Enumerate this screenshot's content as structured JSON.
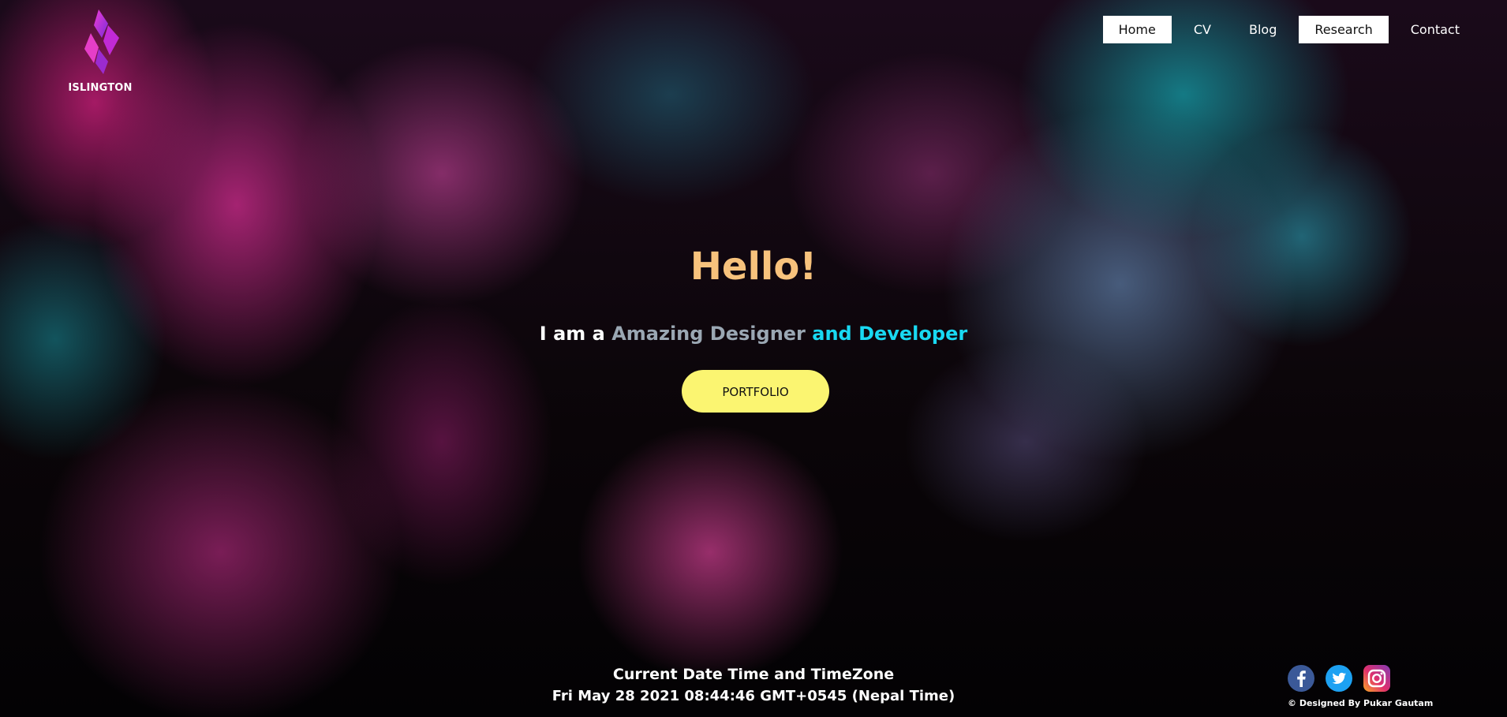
{
  "brand": {
    "name": "ISLINGTON",
    "logo_icon": "islington-logo-icon",
    "logo_colors": [
      "#e02bd0",
      "#7a2bd8"
    ]
  },
  "nav": {
    "items": [
      {
        "label": "Home",
        "active": true
      },
      {
        "label": "CV",
        "active": false
      },
      {
        "label": "Blog",
        "active": false
      },
      {
        "label": "Research",
        "active": true
      },
      {
        "label": "Contact",
        "active": false
      }
    ]
  },
  "hero": {
    "title": "Hello!",
    "subtitle_part1": "I am a ",
    "subtitle_part2": "Amazing Designer",
    "subtitle_part3": " and Developer",
    "button_label": "PORTFOLIO"
  },
  "datetime": {
    "title": "Current Date Time and TimeZone",
    "value": "Fri May 28 2021 08:44:46 GMT+0545 (Nepal Time)"
  },
  "social": {
    "icons": [
      "facebook-icon",
      "twitter-icon",
      "instagram-icon"
    ]
  },
  "footer": {
    "credit": "© Designed By Pukar Gautam"
  },
  "colors": {
    "accent_title": "#f7c27c",
    "accent_cyan": "#19d9f2",
    "button_bg": "#fbf571",
    "facebook": "#3b5998",
    "twitter": "#1da1f2"
  }
}
